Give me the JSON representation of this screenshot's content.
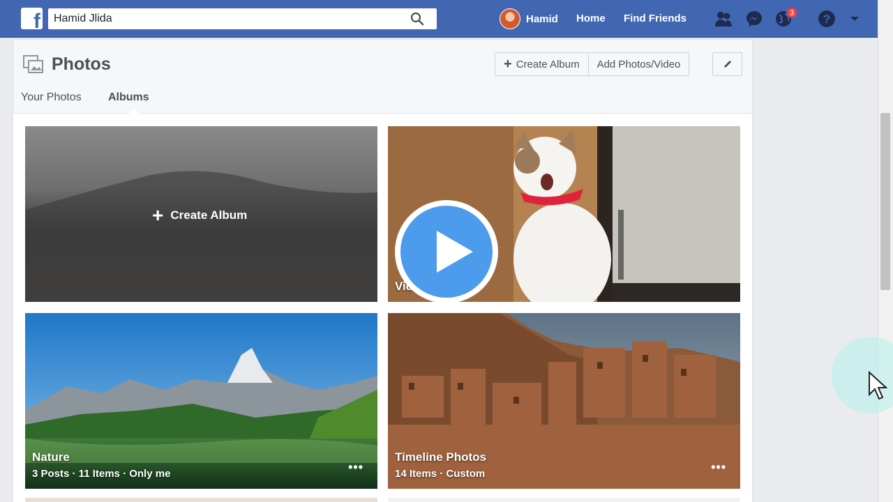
{
  "header": {
    "search_value": "Hamid Jlida",
    "user_name": "Hamid",
    "home_label": "Home",
    "find_friends_label": "Find Friends",
    "notification_count": "3"
  },
  "photos": {
    "title": "Photos",
    "create_album_label": "Create Album",
    "add_photos_label": "Add Photos/Video",
    "tabs": [
      {
        "label": "Your Photos"
      },
      {
        "label": "Albums"
      }
    ]
  },
  "albums": {
    "create_tile_label": "Create Album",
    "video_label": "Vid",
    "items": [
      {
        "title": "Nature",
        "meta": "3 Posts · 11 Items · Only me"
      },
      {
        "title": "Timeline Photos",
        "meta": "14 Items · Custom"
      }
    ]
  },
  "colors": {
    "brand": "#4267b2",
    "play_button": "#4c9bed",
    "badge": "#fa3e3e"
  }
}
